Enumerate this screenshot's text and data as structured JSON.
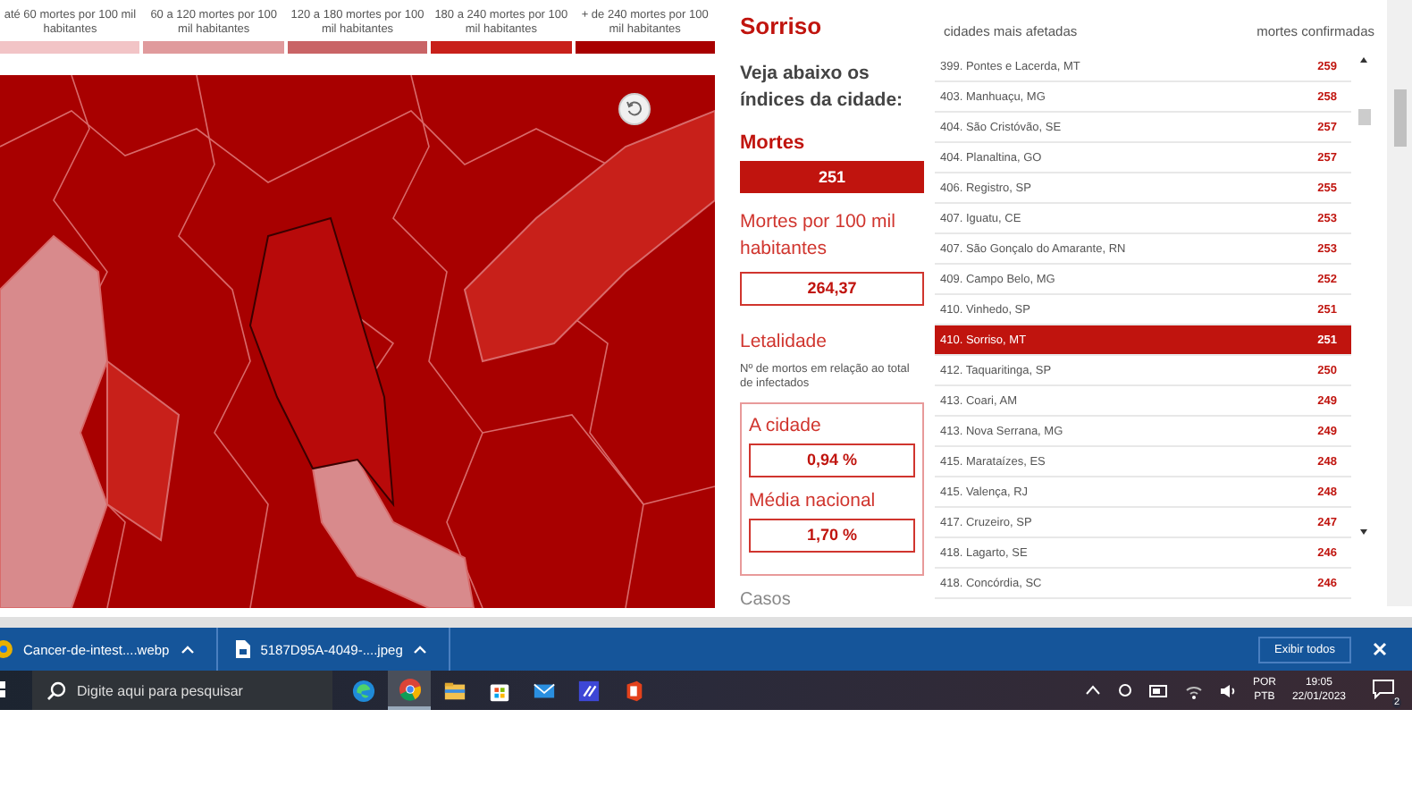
{
  "legend": [
    {
      "label": "até 60 mortes por 100 mil habitantes",
      "color": "#f2c4c6"
    },
    {
      "label": "60 a 120 mortes por 100 mil habitantes",
      "color": "#e09a9c"
    },
    {
      "label": "120 a 180 mortes por 100 mil habitantes",
      "color": "#c96466"
    },
    {
      "label": "180 a 240 mortes por 100 mil habitantes",
      "color": "#c8201a"
    },
    {
      "label": "+ de 240 mortes por 100 mil habitantes",
      "color": "#a80000"
    }
  ],
  "city": {
    "name": "Sorriso",
    "intro": "Veja abaixo os índices da cidade:",
    "deaths_label": "Mortes",
    "deaths": "251",
    "per100k_label": "Mortes por 100 mil habitantes",
    "per100k": "264,37",
    "lethality_label": "Letalidade",
    "lethality_note": "Nº de mortos em relação ao total de infectados",
    "city_label": "A cidade",
    "city_value": "0,94 %",
    "national_label": "Média nacional",
    "national_value": "1,70 %",
    "cases_label": "Casos"
  },
  "ranking": {
    "col_city": "cidades mais afetadas",
    "col_deaths": "mortes confirmadas",
    "rows": [
      {
        "city": "399. Pontes e Lacerda, MT",
        "deaths": "259",
        "selected": false
      },
      {
        "city": "403. Manhuaçu, MG",
        "deaths": "258",
        "selected": false
      },
      {
        "city": "404. São Cristóvão, SE",
        "deaths": "257",
        "selected": false
      },
      {
        "city": "404. Planaltina, GO",
        "deaths": "257",
        "selected": false
      },
      {
        "city": "406. Registro, SP",
        "deaths": "255",
        "selected": false
      },
      {
        "city": "407. Iguatu, CE",
        "deaths": "253",
        "selected": false
      },
      {
        "city": "407. São Gonçalo do Amarante, RN",
        "deaths": "253",
        "selected": false
      },
      {
        "city": "409. Campo Belo, MG",
        "deaths": "252",
        "selected": false
      },
      {
        "city": "410. Vinhedo, SP",
        "deaths": "251",
        "selected": false
      },
      {
        "city": "410. Sorriso, MT",
        "deaths": "251",
        "selected": true
      },
      {
        "city": "412. Taquaritinga, SP",
        "deaths": "250",
        "selected": false
      },
      {
        "city": "413. Coari, AM",
        "deaths": "249",
        "selected": false
      },
      {
        "city": "413. Nova Serrana, MG",
        "deaths": "249",
        "selected": false
      },
      {
        "city": "415. Marataízes, ES",
        "deaths": "248",
        "selected": false
      },
      {
        "city": "415. Valença, RJ",
        "deaths": "248",
        "selected": false
      },
      {
        "city": "417. Cruzeiro, SP",
        "deaths": "247",
        "selected": false
      },
      {
        "city": "418. Lagarto, SE",
        "deaths": "246",
        "selected": false
      },
      {
        "city": "418. Concórdia, SC",
        "deaths": "246",
        "selected": false
      }
    ]
  },
  "downloads": {
    "files": [
      "Cancer-de-intest....webp",
      "5187D95A-4049-....jpeg"
    ],
    "show_all": "Exibir todos"
  },
  "taskbar": {
    "search_placeholder": "Digite aqui para pesquisar",
    "lang_top": "POR",
    "lang_bottom": "PTB",
    "time": "19:05",
    "date": "22/01/2023",
    "notifications": "2"
  }
}
